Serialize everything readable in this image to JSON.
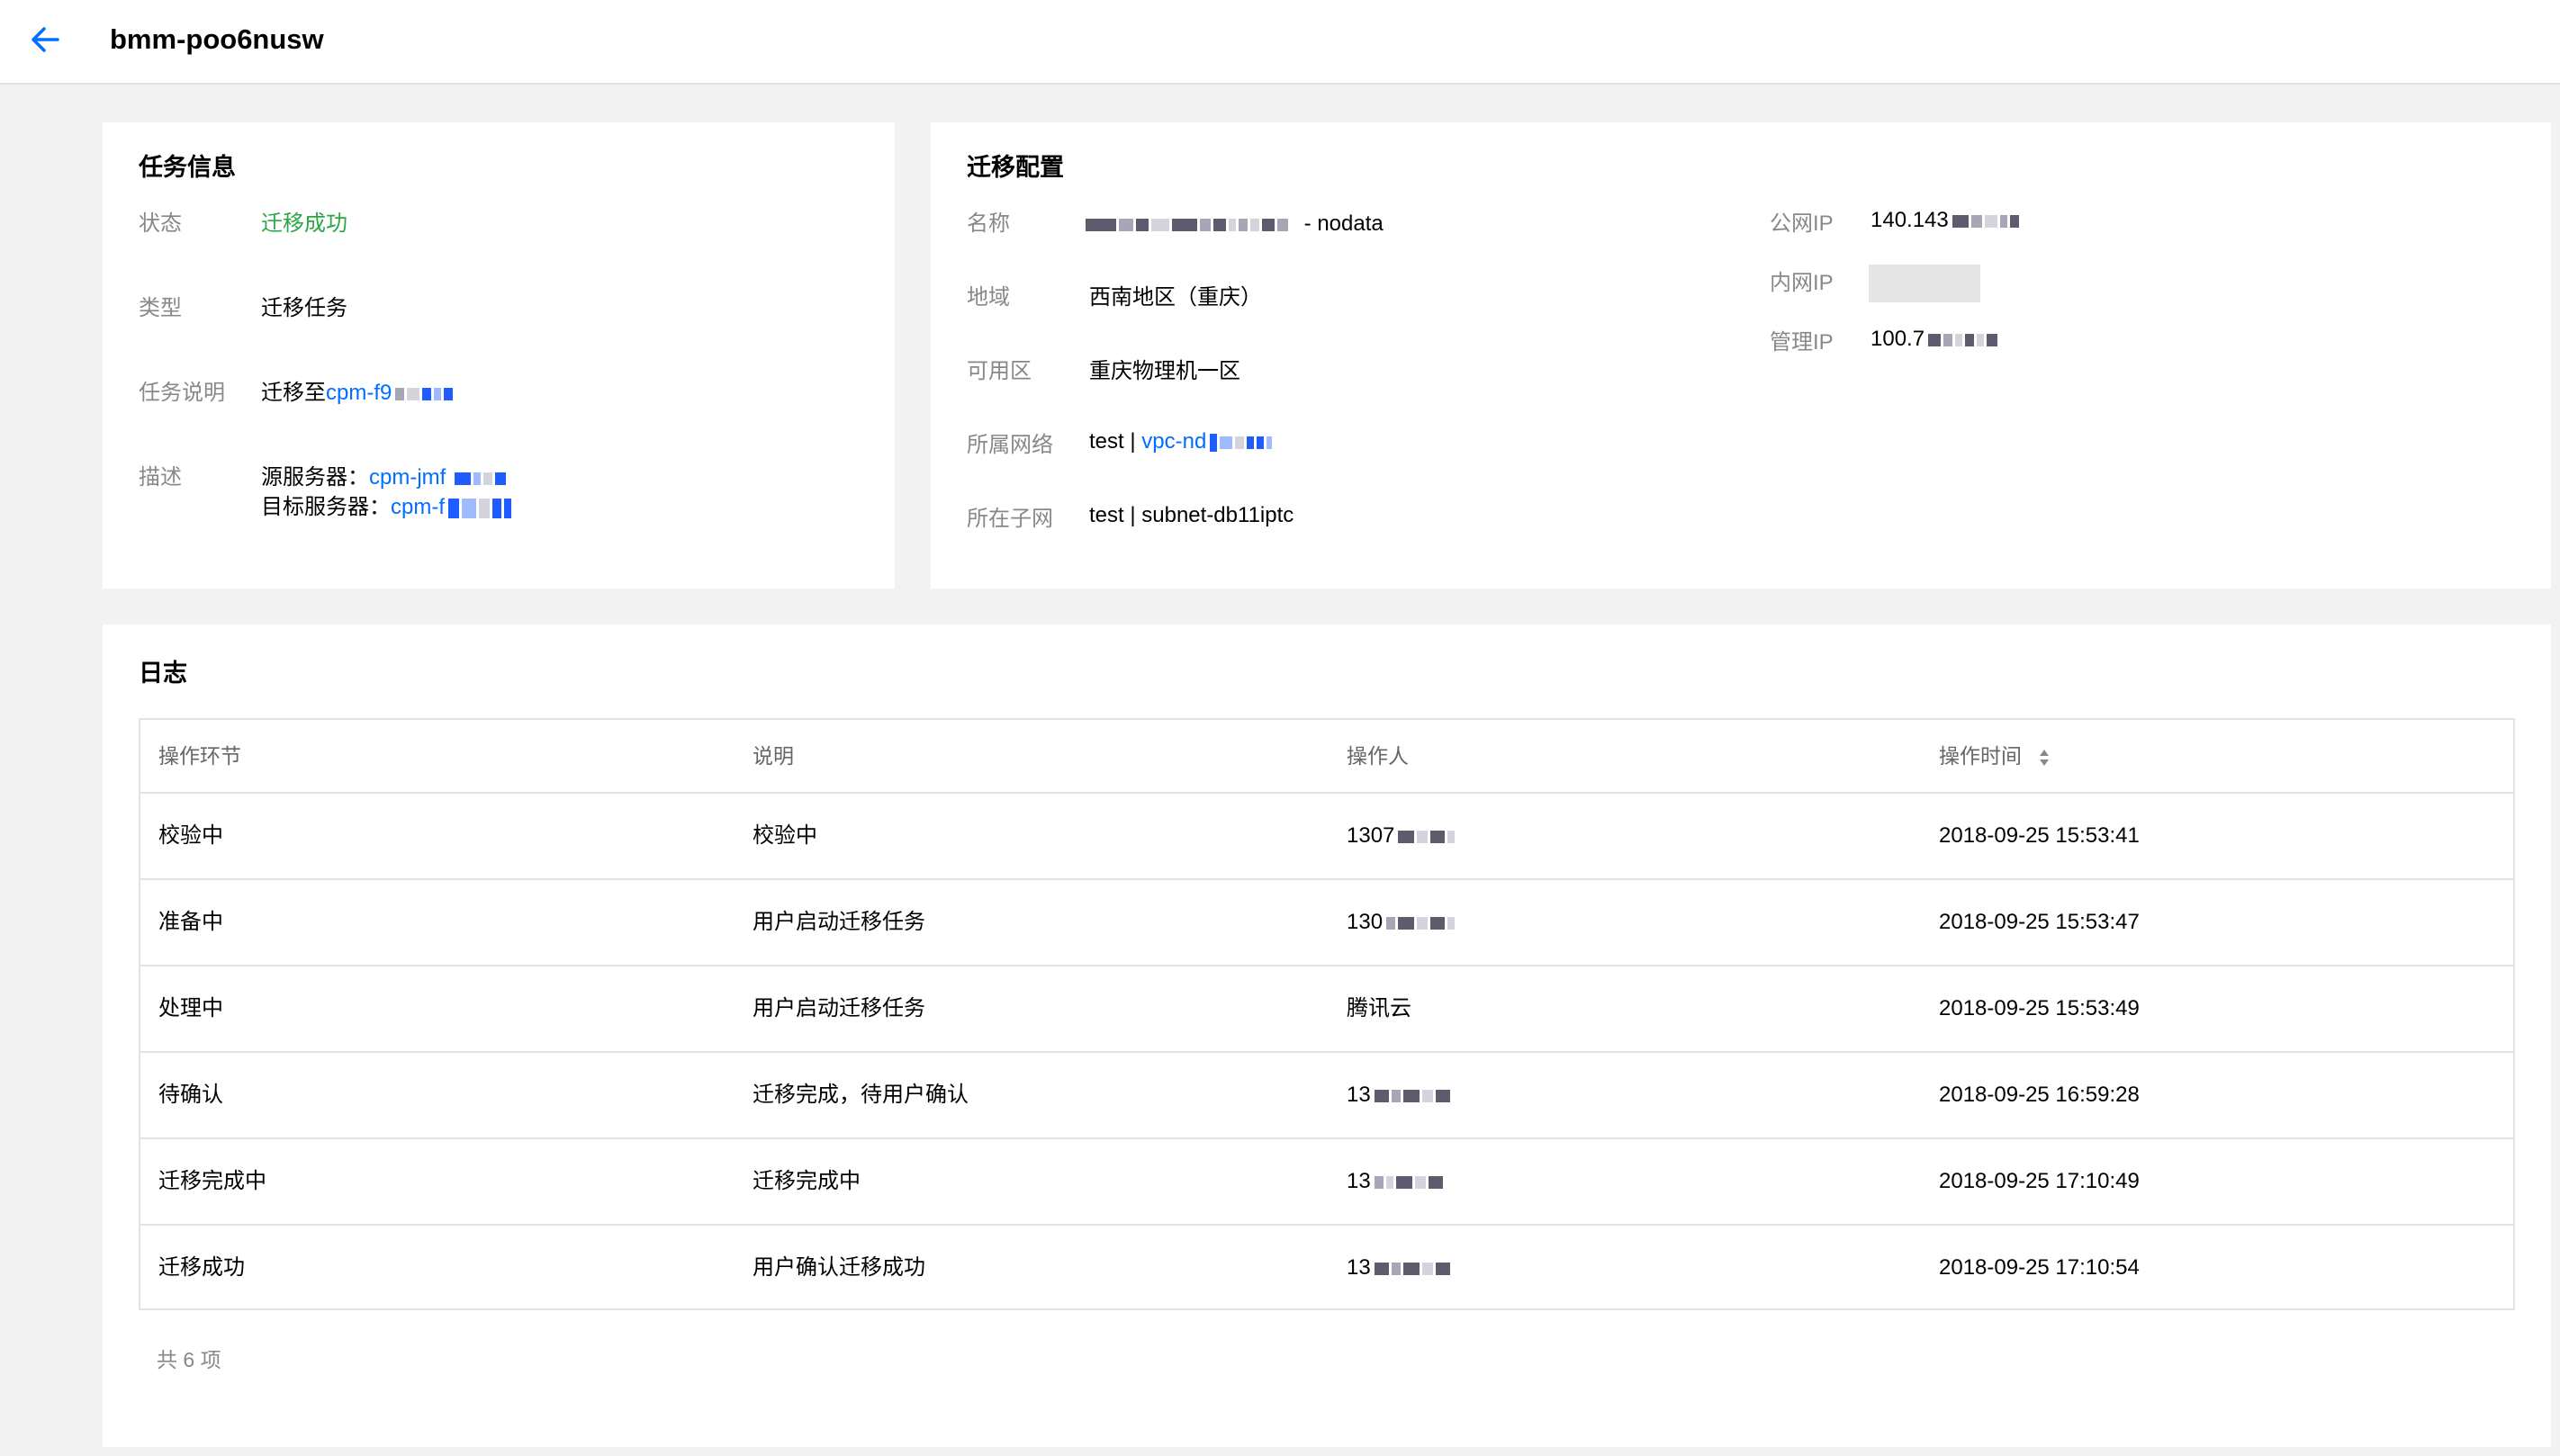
{
  "header": {
    "title": "bmm-poo6nusw"
  },
  "task_info": {
    "title": "任务信息",
    "status_label": "状态",
    "status_value": "迁移成功",
    "type_label": "类型",
    "type_value": "迁移任务",
    "desc_label": "任务说明",
    "desc_prefix": "迁移至",
    "desc_link": "cpm-f9",
    "detail_label": "描述",
    "source_prefix": "源服务器：",
    "source_link": "cpm-jmf",
    "target_prefix": "目标服务器：",
    "target_link": "cpm-f"
  },
  "migration_config": {
    "title": "迁移配置",
    "name_label": "名称",
    "name_suffix": "- nodata",
    "region_label": "地域",
    "region_value": "西南地区（重庆）",
    "zone_label": "可用区",
    "zone_value": "重庆物理机一区",
    "network_label": "所属网络",
    "network_prefix": "test |",
    "network_link": "vpc-nd",
    "subnet_label": "所在子网",
    "subnet_value": "test | subnet-db11iptc",
    "public_ip_label": "公网IP",
    "public_ip_value": "140.143",
    "private_ip_label": "内网IP",
    "private_ip_value": "",
    "mgmt_ip_label": "管理IP",
    "mgmt_ip_value": "100.7"
  },
  "log": {
    "title": "日志",
    "columns": [
      "操作环节",
      "说明",
      "操作人",
      "操作时间"
    ],
    "rows": [
      {
        "step": "校验中",
        "desc": "校验中",
        "operator": "1307",
        "time": "2018-09-25 15:53:41"
      },
      {
        "step": "准备中",
        "desc": "用户启动迁移任务",
        "operator": "130",
        "time": "2018-09-25 15:53:47"
      },
      {
        "step": "处理中",
        "desc": "用户启动迁移任务",
        "operator": "腾讯云",
        "time": "2018-09-25 15:53:49"
      },
      {
        "step": "待确认",
        "desc": "迁移完成，待用户确认",
        "operator": "13",
        "time": "2018-09-25 16:59:28"
      },
      {
        "step": "迁移完成中",
        "desc": "迁移完成中",
        "operator": "13",
        "time": "2018-09-25 17:10:49"
      },
      {
        "step": "迁移成功",
        "desc": "用户确认迁移成功",
        "operator": "13",
        "time": "2018-09-25 17:10:54"
      }
    ],
    "total": "共 6 项"
  },
  "colors": {
    "link": "#006eff",
    "success": "#29a745",
    "label": "#888888"
  },
  "icons": {
    "back": "arrow-left-icon",
    "sort": "sort-icon"
  }
}
